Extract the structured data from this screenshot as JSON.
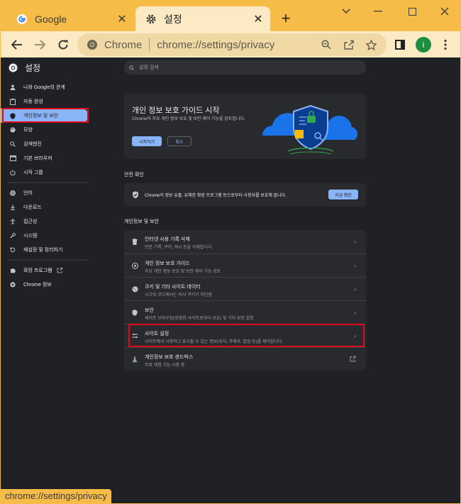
{
  "tabs": [
    {
      "title": "Google",
      "favicon": "google-g-icon"
    },
    {
      "title": "설정",
      "favicon": "gear-icon"
    }
  ],
  "window_controls": [
    "minimize-icon",
    "maximize-icon",
    "close-icon"
  ],
  "toolbar": {
    "site_label": "Chrome",
    "url": "chrome://settings/privacy",
    "avatar_letter": "i"
  },
  "settings": {
    "title": "설정",
    "search_placeholder": "설정 검색"
  },
  "sidebar": {
    "items": [
      {
        "label": "나와 Google의 관계",
        "icon": "person-icon"
      },
      {
        "label": "자동 완성",
        "icon": "clipboard-icon"
      },
      {
        "label": "개인정보 및 보안",
        "icon": "shield-icon",
        "selected": true
      },
      {
        "label": "모양",
        "icon": "palette-icon"
      },
      {
        "label": "검색엔진",
        "icon": "search-icon"
      },
      {
        "label": "기본 브라우저",
        "icon": "browser-icon"
      },
      {
        "label": "시작 그룹",
        "icon": "power-icon"
      },
      {
        "label": "언어",
        "icon": "globe-icon"
      },
      {
        "label": "다운로드",
        "icon": "download-icon"
      },
      {
        "label": "접근성",
        "icon": "accessibility-icon"
      },
      {
        "label": "시스템",
        "icon": "wrench-icon"
      },
      {
        "label": "재설정 및 정리하기",
        "icon": "reset-icon"
      },
      {
        "label": "확장 프로그램",
        "icon": "puzzle-icon"
      },
      {
        "label": "Chrome 정보",
        "icon": "chrome-icon"
      }
    ]
  },
  "privacy_guide": {
    "title": "개인 정보 보호 가이드 시작",
    "description": "Chrome의 주요 개인 정보 보호 및 보안 제어 기능을 검토합니다.",
    "start_button": "시작하기",
    "cancel_button": "취소"
  },
  "safety_check": {
    "heading": "안전 확인",
    "text": "Chrome이 정보 유출, 유해한 확장 프로그램 등으로부터 사용자를 보호해 줍니다.",
    "button": "지금 확인"
  },
  "privacy_section": {
    "heading": "개인정보 및 보안",
    "rows": [
      {
        "title": "인터넷 사용 기록 삭제",
        "subtitle": "방문 기록, 쿠키, 캐시 등을 삭제합니다.",
        "icon": "trash-icon"
      },
      {
        "title": "개인 정보 보호 가이드",
        "subtitle": "주요 개인 정보 보호 및 보안 제어 기능 검토",
        "icon": "guide-icon"
      },
      {
        "title": "쿠키 및 기타 사이트 데이터",
        "subtitle": "시크릿 모드에서는 타사 쿠키가 차단됨",
        "icon": "cookie-icon"
      },
      {
        "title": "보안",
        "subtitle": "세이프 브라우징(위험한 사이트로부터 보호) 및 기타 보안 설정",
        "icon": "shield-icon"
      },
      {
        "title": "사이트 설정",
        "subtitle": "사이트에서 사용하고 표시할 수 있는 정보(위치, 카메라, 팝업 등)를 제어합니다.",
        "icon": "sliders-icon"
      },
      {
        "title": "개인정보 보호 샌드박스",
        "subtitle": "무료 체험 기능 사용 중",
        "icon": "flask-icon"
      }
    ]
  },
  "status_bar": "chrome://settings/privacy"
}
